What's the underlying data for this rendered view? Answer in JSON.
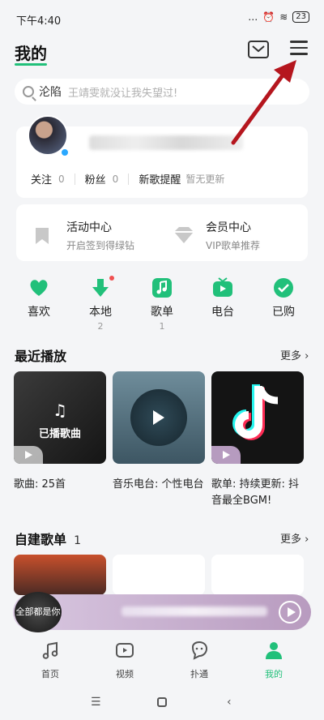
{
  "status_bar": {
    "time": "下午4:40",
    "signal": "…",
    "battery": "23"
  },
  "header": {
    "title": "我的"
  },
  "search": {
    "keyword": "沦陷",
    "hint": "王靖雯就没让我失望过!"
  },
  "profile": {
    "follow_label": "关注",
    "follow_count": "0",
    "fans_label": "粉丝",
    "fans_count": "0",
    "new_song_label": "新歌提醒",
    "new_song_status": "暂无更新"
  },
  "centers": [
    {
      "title": "活动中心",
      "sub": "开启签到得绿钻"
    },
    {
      "title": "会员中心",
      "sub": "VIP歌单推荐"
    }
  ],
  "quick_items": [
    {
      "label": "喜欢",
      "count": ""
    },
    {
      "label": "本地",
      "count": "2"
    },
    {
      "label": "歌单",
      "count": "1"
    },
    {
      "label": "电台",
      "count": ""
    },
    {
      "label": "已购",
      "count": ""
    }
  ],
  "recent": {
    "title": "最近播放",
    "more": "更多",
    "items": [
      {
        "cover_text": "已播歌曲",
        "caption": "歌曲: 25首"
      },
      {
        "caption": "音乐电台: 个性电台"
      },
      {
        "caption": "歌单: 持续更新: 抖音最全BGM!"
      }
    ]
  },
  "playlists": {
    "title": "自建歌单",
    "count": "1",
    "more": "更多"
  },
  "mini_player": {
    "cover_text": "全部都是你"
  },
  "tabs": [
    {
      "label": "首页"
    },
    {
      "label": "视频"
    },
    {
      "label": "扑通"
    },
    {
      "label": "我的"
    }
  ],
  "colors": {
    "accent": "#21c07a",
    "arrow": "#b5161e"
  }
}
